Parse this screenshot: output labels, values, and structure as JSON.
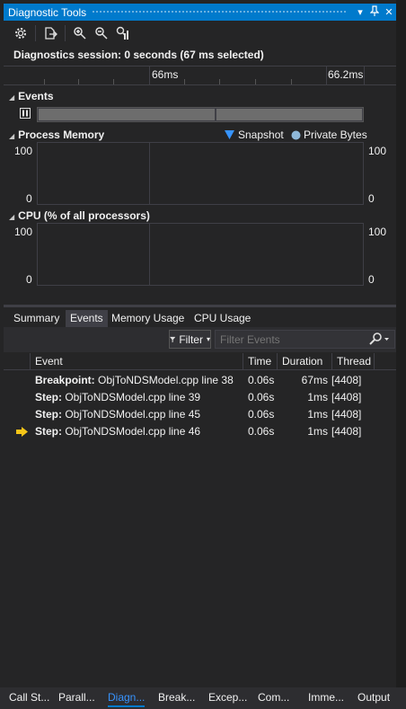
{
  "window": {
    "title": "Diagnostic Tools",
    "buttons": {
      "dropdown": "▾",
      "pin": "⊥",
      "close": "✕"
    }
  },
  "toolbar": {
    "icons": [
      "settings-icon",
      "export-icon",
      "zoom-in-icon",
      "zoom-out-icon",
      "reset-zoom-icon"
    ]
  },
  "session": {
    "text": "Diagnostics session: 0 seconds (67 ms selected)"
  },
  "ruler": {
    "label_left": "66ms",
    "label_right": "66.2ms"
  },
  "events_section": {
    "title": "Events"
  },
  "memory_section": {
    "title": "Process Memory",
    "legend_snapshot": "Snapshot",
    "legend_private": "Private Bytes",
    "axis_top_left": "100",
    "axis_bottom_left": "0",
    "axis_top_right": "100",
    "axis_bottom_right": "0"
  },
  "cpu_section": {
    "title": "CPU (% of all processors)",
    "axis_top_left": "100",
    "axis_bottom_left": "0",
    "axis_top_right": "100",
    "axis_bottom_right": "0"
  },
  "tabs": [
    {
      "label": "Summary",
      "active": false
    },
    {
      "label": "Events",
      "active": true
    },
    {
      "label": "Memory Usage",
      "active": false
    },
    {
      "label": "CPU Usage",
      "active": false
    }
  ],
  "filter": {
    "label": "Filter",
    "placeholder": "Filter Events"
  },
  "grid": {
    "columns": [
      "Event",
      "Time",
      "Duration",
      "Thread"
    ],
    "rows": [
      {
        "kind": "Breakpoint:",
        "desc": "ObjToNDSModel.cpp line 38",
        "time": "0.06s",
        "duration": "67ms",
        "thread": "[4408]",
        "current": false
      },
      {
        "kind": "Step:",
        "desc": "ObjToNDSModel.cpp line 39",
        "time": "0.06s",
        "duration": "1ms",
        "thread": "[4408]",
        "current": false
      },
      {
        "kind": "Step:",
        "desc": "ObjToNDSModel.cpp line 45",
        "time": "0.06s",
        "duration": "1ms",
        "thread": "[4408]",
        "current": false
      },
      {
        "kind": "Step:",
        "desc": "ObjToNDSModel.cpp line 46",
        "time": "0.06s",
        "duration": "1ms",
        "thread": "[4408]",
        "current": true
      }
    ]
  },
  "bottom_tabs": [
    {
      "label": "Call St...",
      "active": false
    },
    {
      "label": "Parall...",
      "active": false
    },
    {
      "label": "Diagn...",
      "active": true
    },
    {
      "label": "Break...",
      "active": false
    },
    {
      "label": "Excep...",
      "active": false
    },
    {
      "label": "Com...",
      "active": false
    },
    {
      "label": "Imme...",
      "active": false
    },
    {
      "label": "Output",
      "active": false
    }
  ],
  "colors": {
    "accent": "#007acc",
    "snapshot_marker": "#3794ff",
    "private_bytes_marker": "#8fb8d8",
    "current_arrow": "#f5c518"
  }
}
